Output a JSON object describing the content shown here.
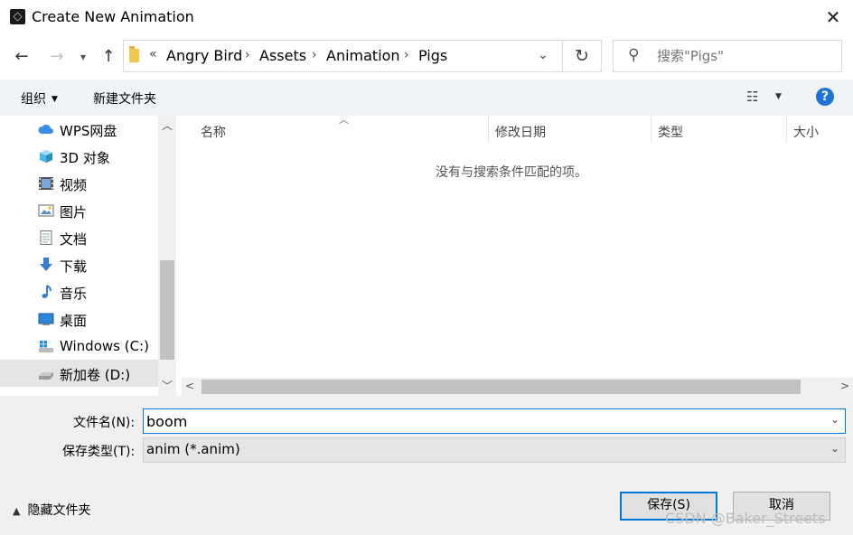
{
  "window": {
    "title": "Create New Animation"
  },
  "nav": {
    "path_overflow": "«",
    "crumbs": [
      "Angry Bird",
      "Assets",
      "Animation",
      "Pigs"
    ],
    "search_placeholder": "搜索\"Pigs\""
  },
  "toolbar": {
    "organize": "组织",
    "new_folder": "新建文件夹"
  },
  "sidebar": {
    "items": [
      {
        "label": "WPS网盘",
        "icon": "cloud-icon"
      },
      {
        "label": "3D 对象",
        "icon": "cube-icon"
      },
      {
        "label": "视频",
        "icon": "video-icon"
      },
      {
        "label": "图片",
        "icon": "picture-icon"
      },
      {
        "label": "文档",
        "icon": "document-icon"
      },
      {
        "label": "下载",
        "icon": "download-icon"
      },
      {
        "label": "音乐",
        "icon": "music-icon"
      },
      {
        "label": "桌面",
        "icon": "desktop-icon"
      },
      {
        "label": "Windows (C:)",
        "icon": "windows-drive-icon"
      },
      {
        "label": "新加卷 (D:)",
        "icon": "drive-icon",
        "selected": true
      }
    ]
  },
  "filelist": {
    "columns": [
      "名称",
      "修改日期",
      "类型",
      "大小"
    ],
    "empty_message": "没有与搜索条件匹配的项。"
  },
  "form": {
    "filename_label": "文件名(N):",
    "filename_value": "boom",
    "filetype_label": "保存类型(T):",
    "filetype_value": "anim (*.anim)"
  },
  "footer": {
    "hide_folders": "隐藏文件夹",
    "save": "保存(S)",
    "cancel": "取消",
    "watermark": "CSDN @Baker_Streets"
  },
  "colors": {
    "accent": "#0078d7",
    "help": "#1e73d8"
  }
}
